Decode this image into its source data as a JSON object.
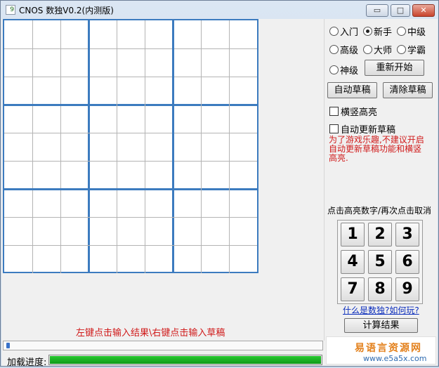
{
  "window": {
    "title": "CNOS 数独V0.2(内测版)",
    "icon_text": "9",
    "minimize_symbol": "▭",
    "maximize_symbol": "□",
    "close_symbol": "✕"
  },
  "board": {
    "rows": 9,
    "cols": 9,
    "cells": [
      [
        "",
        "",
        "",
        "",
        "",
        "",
        "",
        "",
        ""
      ],
      [
        "",
        "",
        "",
        "",
        "",
        "",
        "",
        "",
        ""
      ],
      [
        "",
        "",
        "",
        "",
        "",
        "",
        "",
        "",
        ""
      ],
      [
        "",
        "",
        "",
        "",
        "",
        "",
        "",
        "",
        ""
      ],
      [
        "",
        "",
        "",
        "",
        "",
        "",
        "",
        "",
        ""
      ],
      [
        "",
        "",
        "",
        "",
        "",
        "",
        "",
        "",
        ""
      ],
      [
        "",
        "",
        "",
        "",
        "",
        "",
        "",
        "",
        ""
      ],
      [
        "",
        "",
        "",
        "",
        "",
        "",
        "",
        "",
        ""
      ],
      [
        "",
        "",
        "",
        "",
        "",
        "",
        "",
        "",
        ""
      ]
    ],
    "box_line_color": "#3c7bbf",
    "cell_line_color": "#b4b4b4"
  },
  "difficulty": {
    "options": [
      "入门",
      "新手",
      "中级",
      "高级",
      "大师",
      "学霸",
      "神级"
    ],
    "selected": "新手"
  },
  "buttons": {
    "restart": "重新开始",
    "auto_draft": "自动草稿",
    "clear_draft": "清除草稿",
    "compute": "计算结果"
  },
  "options": {
    "highlight_rowcol": {
      "label": "横竖高亮",
      "checked": false
    },
    "auto_update_draft": {
      "label": "自动更新草稿",
      "checked": false
    }
  },
  "warning_text": "为了游戏乐趣,不建议开启自动更新草稿功能和横竖高亮.",
  "numpad": {
    "hint": "点击高亮数字/再次点击取消",
    "digits": [
      "1",
      "2",
      "3",
      "4",
      "5",
      "6",
      "7",
      "8",
      "9"
    ]
  },
  "help_link": "什么是数独?如何玩?",
  "instruction": "左键点击输入结果\\右键点击输入草稿",
  "progress": {
    "label": "加载进度:",
    "value": 1.0,
    "color": "#1aaf22"
  },
  "ad": {
    "brand": "易语言资源网",
    "url": "www.e5a5x.com"
  },
  "scrollbar": {
    "position": 0
  }
}
